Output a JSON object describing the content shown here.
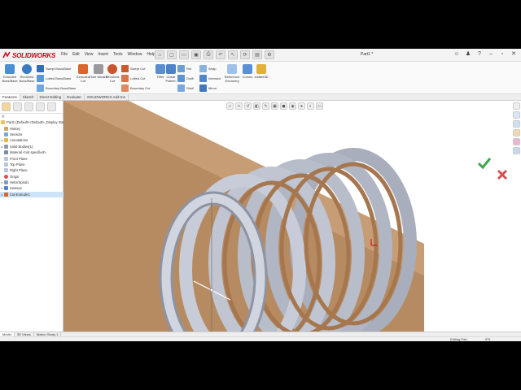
{
  "app": {
    "brand": "SOLIDWORKS",
    "document_title": "Part1 *",
    "menus": [
      "File",
      "Edit",
      "View",
      "Insert",
      "Tools",
      "Window",
      "Help"
    ]
  },
  "toolbar": {
    "extruded_boss": "Extruded Boss/Base",
    "revolved_boss": "Revolved Boss/Base",
    "swept_boss": "Swept Boss/Base",
    "lofted_boss": "Lofted Boss/Base",
    "boundary_boss": "Boundary Boss/Base",
    "extruded_cut": "Extruded Cut",
    "hole_wizard": "Hole Wizard",
    "revolved_cut": "Revolved Cut",
    "swept_cut": "Swept Cut",
    "lofted_cut": "Lofted Cut",
    "boundary_cut": "Boundary Cut",
    "fillet": "Fillet",
    "linear_pattern": "Linear Pattern",
    "rib": "Rib",
    "draft": "Draft",
    "shell": "Shell",
    "wrap": "Wrap",
    "intersect": "Intersect",
    "mirror": "Mirror",
    "reference_geometry": "Reference Geometry",
    "curves": "Curves",
    "instant3d": "Instant3D"
  },
  "tabs": [
    "Features",
    "Sketch",
    "Direct Editing",
    "Evaluate",
    "SOLIDWORKS Add-Ins"
  ],
  "active_tab": "Features",
  "feature_tree": {
    "root": "Part1 (Default<<Default>_Display Sta",
    "items": [
      {
        "label": "History",
        "expand": ""
      },
      {
        "label": "Sensors",
        "expand": ""
      },
      {
        "label": "Annotations",
        "expand": "▸"
      },
      {
        "label": "Solid Bodies(1)",
        "expand": "▸"
      },
      {
        "label": "Material <not specified>",
        "expand": ""
      },
      {
        "label": "Front Plane",
        "expand": ""
      },
      {
        "label": "Top Plane",
        "expand": ""
      },
      {
        "label": "Right Plane",
        "expand": ""
      },
      {
        "label": "Origin",
        "expand": ""
      },
      {
        "label": "Helix/Spiral1",
        "expand": "▸"
      },
      {
        "label": "Sweep1",
        "expand": "▸"
      },
      {
        "label": "Cut-Extrude1",
        "expand": "▸"
      }
    ]
  },
  "breadcrumb": "Part1 (Default<<Default>...",
  "bottom_tabs": [
    "Model",
    "3D Views",
    "Motion Study 1"
  ],
  "active_bottom_tab": "Model",
  "status": {
    "mode": "Editing Part",
    "units": "IPS"
  },
  "colors": {
    "plane": "#b98a5e",
    "spring": "#c7ccd8",
    "spring_inner": "#a6774e",
    "accent": "#d0021b"
  }
}
